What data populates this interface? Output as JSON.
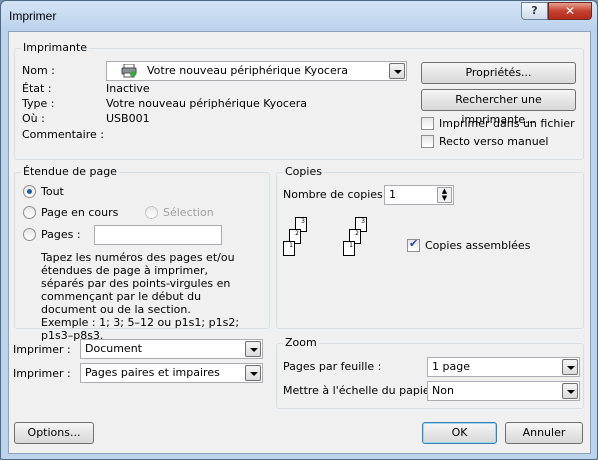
{
  "window": {
    "title": "Imprimer",
    "help_label": "?",
    "close_label": "✕"
  },
  "printer": {
    "group_label": "Imprimante",
    "name_label": "Nom :",
    "name_value": "Votre nouveau périphérique Kyocera",
    "state_label": "État :",
    "state_value": "Inactive",
    "type_label": "Type :",
    "type_value": "Votre nouveau périphérique Kyocera",
    "where_label": "Où :",
    "where_value": "USB001",
    "comment_label": "Commentaire :",
    "properties_btn": "Propriétés...",
    "find_printer_btn": "Rechercher une imprimante...",
    "print_to_file": "Imprimer dans un fichier",
    "manual_duplex": "Recto verso manuel"
  },
  "range": {
    "group_label": "Étendue de page",
    "all": "Tout",
    "current": "Page en cours",
    "selection": "Sélection",
    "pages": "Pages :",
    "help": "Tapez les numéros des pages et/ou étendues de page à imprimer, séparés par des points-virgules en commençant par le début du document ou de la section. Exemple : 1; 3; 5–12 ou p1s1; p1s2; p1s3–p8s3.",
    "selected": "all"
  },
  "copies": {
    "group_label": "Copies",
    "count_label": "Nombre de copies :",
    "count_value": "1",
    "collate_label": "Copies assemblées",
    "collate_checked": true
  },
  "print_what": {
    "label": "Imprimer :",
    "value": "Document"
  },
  "print_pages": {
    "label": "Imprimer :",
    "value": "Pages paires et impaires"
  },
  "zoom": {
    "group_label": "Zoom",
    "per_sheet_label": "Pages par feuille :",
    "per_sheet_value": "1 page",
    "scale_label": "Mettre à l'échelle du papier :",
    "scale_value": "Non"
  },
  "footer": {
    "options_btn": "Options...",
    "ok_btn": "OK",
    "cancel_btn": "Annuler"
  }
}
